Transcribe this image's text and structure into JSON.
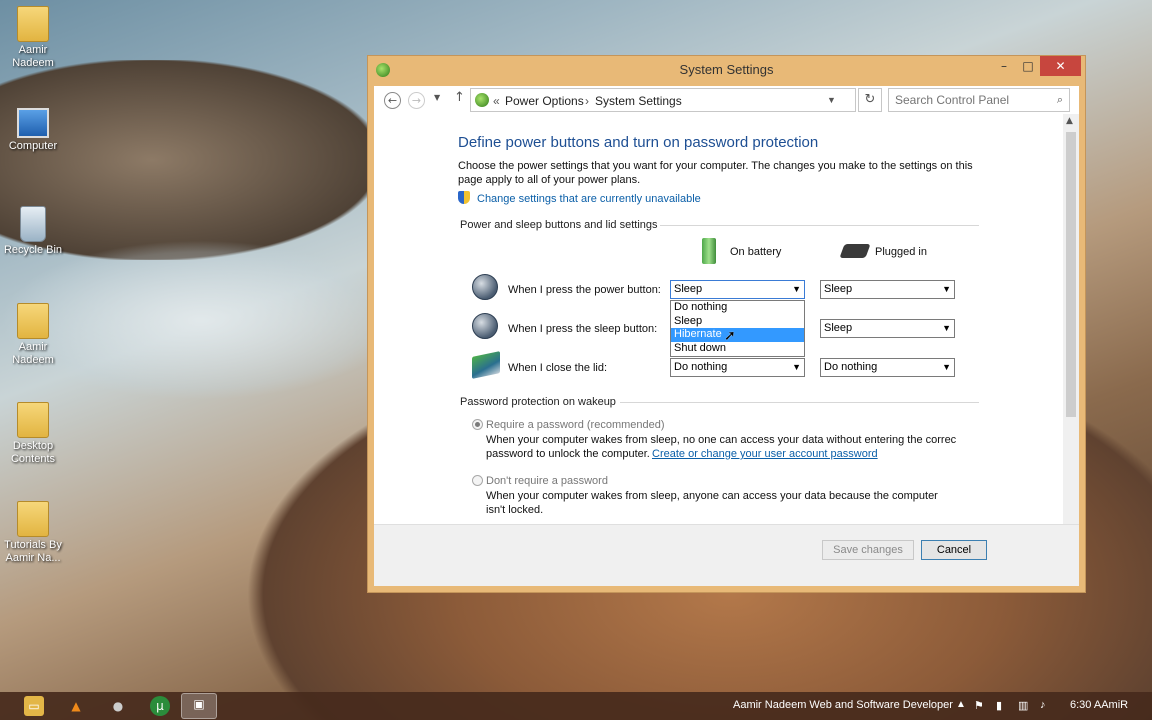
{
  "desktop": {
    "icons": [
      {
        "label": "Aamir\nNadeem",
        "icon": "user-folder-icon"
      },
      {
        "label": "Computer",
        "icon": "computer-icon"
      },
      {
        "label": "Recycle Bin",
        "icon": "recycle-bin-icon"
      },
      {
        "label": "Aamir\nNadeem",
        "icon": "folder-icon"
      },
      {
        "label": "Desktop\nContents",
        "icon": "folder-icon"
      },
      {
        "label": "Tutorials By\nAamir Na...",
        "icon": "folder-shortcut-icon"
      }
    ]
  },
  "window": {
    "title": "System Settings",
    "address": {
      "prefix": "«",
      "crumb1": "Power Options",
      "separator": "›",
      "crumb2": "System Settings"
    },
    "search_placeholder": "Search Control Panel",
    "heading": "Define power buttons and turn on password protection",
    "intro": "Choose the power settings that you want for your computer. The changes you make to the settings on this page apply to all of your power plans.",
    "change_link": "Change settings that are currently unavailable",
    "section1": "Power and sleep buttons and lid settings",
    "col_battery": "On battery",
    "col_plugged": "Plugged in",
    "rows": [
      {
        "label": "When I press the power button:",
        "battery": "Sleep",
        "plugged": "Sleep"
      },
      {
        "label": "When I press the sleep button:",
        "battery": "Sleep",
        "plugged": "Sleep"
      },
      {
        "label": "When I close the lid:",
        "battery": "Do nothing",
        "plugged": "Do nothing"
      }
    ],
    "dropdown_options": [
      "Do nothing",
      "Sleep",
      "Hibernate",
      "Shut down"
    ],
    "dropdown_highlighted": "Hibernate",
    "section2": "Password protection on wakeup",
    "opt1_label": "Require a password (recommended)",
    "opt1_desc": "When your computer wakes from sleep, no one can access your data without entering the correct password to unlock the computer.",
    "opt1_link": "Create or change your user account password",
    "opt2_label": "Don't require a password",
    "opt2_desc": "When your computer wakes from sleep, anyone can access your data because the computer isn't locked.",
    "save_label": "Save changes",
    "cancel_label": "Cancel",
    "controls": {
      "minimize": "–",
      "maximize": "□",
      "close": "✕"
    }
  },
  "taskbar": {
    "tray_text": "Aamir Nadeem Web and Software Developer",
    "clock": "6:30 AAmiR"
  },
  "colors": {
    "window_frame": "#e8b977",
    "heading_blue": "#1e4f93",
    "link_blue": "#0b5fa8",
    "close_red": "#c7463e"
  }
}
